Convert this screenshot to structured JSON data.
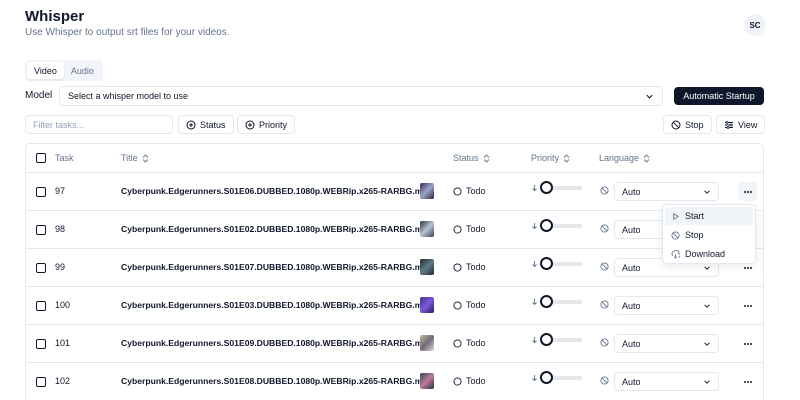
{
  "app": {
    "title": "Whisper",
    "subtitle": "Use Whisper to output srt files for your videos.",
    "avatar_initials": "SC"
  },
  "tabs": [
    {
      "label": "Video",
      "active": true
    },
    {
      "label": "Audio",
      "active": false
    }
  ],
  "model": {
    "label": "Model",
    "placeholder": "Select a whisper model to use"
  },
  "toolbar": {
    "automatic_startup_label": "Automatic Startup",
    "filter_placeholder": "Filter tasks...",
    "status_filter_label": "Status",
    "priority_filter_label": "Priority",
    "stop_label": "Stop",
    "view_label": "View"
  },
  "table": {
    "columns": {
      "task": "Task",
      "title": "Title",
      "status": "Status",
      "priority": "Priority",
      "language": "Language"
    },
    "rows": [
      {
        "task": "97",
        "title": "Cyberpunk.Edgerunners.S01E06.DUBBED.1080p.WEBRip.x265-RARBG.m...",
        "status": "Todo",
        "priority": 0,
        "language": "Auto"
      },
      {
        "task": "98",
        "title": "Cyberpunk.Edgerunners.S01E02.DUBBED.1080p.WEBRip.x265-RARBG.m...",
        "status": "Todo",
        "priority": 0,
        "language": "Auto"
      },
      {
        "task": "99",
        "title": "Cyberpunk.Edgerunners.S01E07.DUBBED.1080p.WEBRip.x265-RARBG.m...",
        "status": "Todo",
        "priority": 0,
        "language": "Auto"
      },
      {
        "task": "100",
        "title": "Cyberpunk.Edgerunners.S01E03.DUBBED.1080p.WEBRip.x265-RARBG.m...",
        "status": "Todo",
        "priority": 0,
        "language": "Auto"
      },
      {
        "task": "101",
        "title": "Cyberpunk.Edgerunners.S01E09.DUBBED.1080p.WEBRip.x265-RARBG.m...",
        "status": "Todo",
        "priority": 0,
        "language": "Auto"
      },
      {
        "task": "102",
        "title": "Cyberpunk.Edgerunners.S01E08.DUBBED.1080p.WEBRip.x265-RARBG.m...",
        "status": "Todo",
        "priority": 0,
        "language": "Auto"
      }
    ]
  },
  "row_menu": {
    "items": [
      {
        "label": "Start",
        "icon": "play-icon"
      },
      {
        "label": "Stop",
        "icon": "stop-icon"
      },
      {
        "label": "Download",
        "icon": "download-icon"
      }
    ]
  },
  "colors": {
    "primary": "#0f172a",
    "muted": "#64748b",
    "border": "#e2e8f0"
  }
}
